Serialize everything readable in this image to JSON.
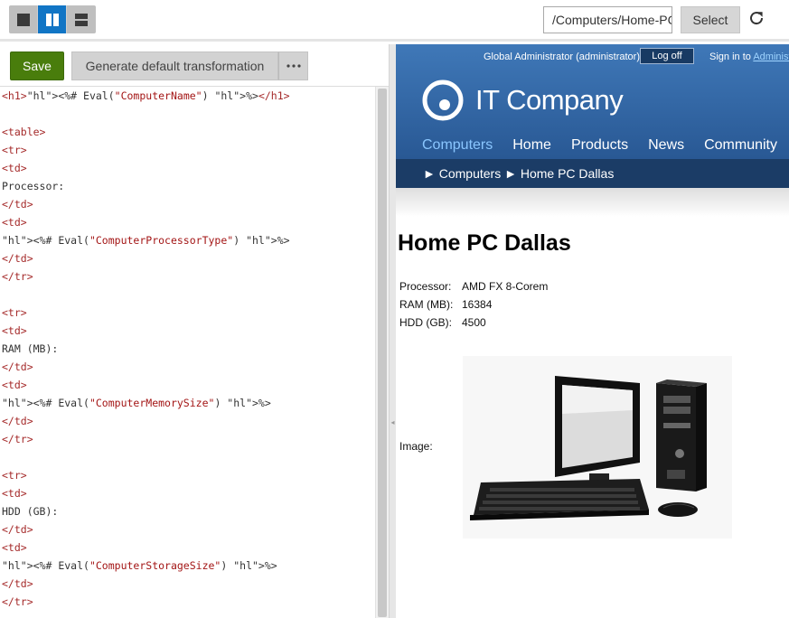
{
  "toolbar": {
    "view_modes": [
      "single-view",
      "split-view",
      "horizontal-split-view"
    ],
    "active_view": "split-view",
    "path_value": "/Computers/Home-PC-Dallas",
    "select_label": "Select"
  },
  "editor": {
    "save_label": "Save",
    "generate_label": "Generate default transformation",
    "more_label": "⋯",
    "code_lines": [
      "<h1><%# Eval(\"ComputerName\") %></h1>",
      "",
      "<table>",
      "<tr>",
      "<td>",
      "Processor:",
      "</td>",
      "<td>",
      "<%# Eval(\"ComputerProcessorType\") %>",
      "</td>",
      "</tr>",
      "",
      "<tr>",
      "<td>",
      "RAM (MB):",
      "</td>",
      "<td>",
      "<%# Eval(\"ComputerMemorySize\") %>",
      "</td>",
      "</tr>",
      "",
      "<tr>",
      "<td>",
      "HDD (GB):",
      "</td>",
      "<td>",
      "<%# Eval(\"ComputerStorageSize\") %>",
      "</td>",
      "</tr>"
    ]
  },
  "preview": {
    "admin": {
      "user": "Global Administrator (administrator)",
      "logoff_label": "Log off",
      "signin_prefix": "Sign in to",
      "signin_link": "Administration"
    },
    "site_name": "IT Company",
    "nav": [
      "Computers",
      "Home",
      "Products",
      "News",
      "Community"
    ],
    "active_nav": "Computers",
    "breadcrumb": "► Computers ► Home PC Dallas",
    "title": "Home PC Dallas",
    "specs": [
      {
        "label": "Processor:",
        "value": "AMD FX 8-Corem"
      },
      {
        "label": "RAM (MB):",
        "value": "16384"
      },
      {
        "label": "HDD (GB):",
        "value": "4500"
      }
    ],
    "image_label": "Image:"
  },
  "colors": {
    "accent": "#1175c5",
    "save_green": "#497d0c",
    "header_blue": "#2a5a96",
    "breadcrumb_bar": "#1b3c66",
    "nav_active": "#8ac6ff"
  }
}
